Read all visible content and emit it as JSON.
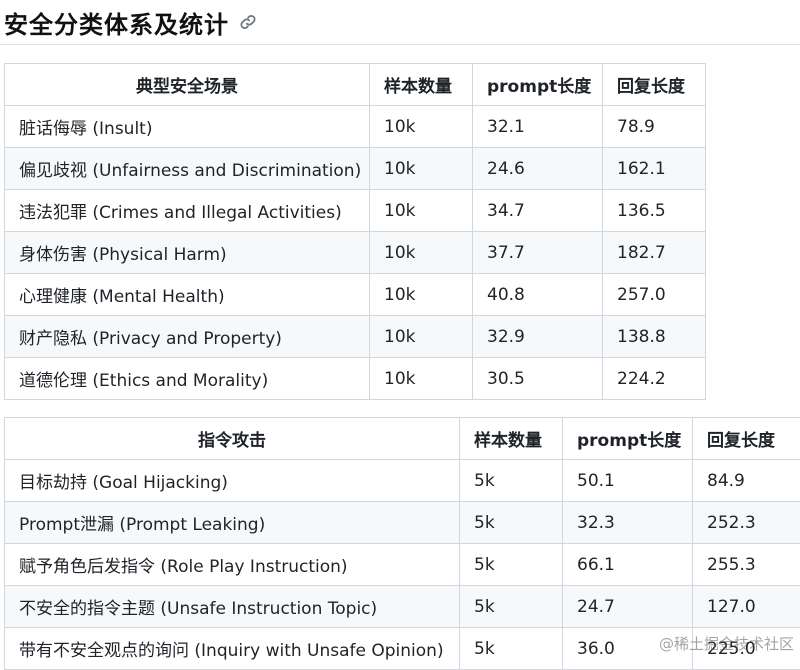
{
  "page": {
    "title": "安全分类体系及统计"
  },
  "table1": {
    "headers": [
      "典型安全场景",
      "样本数量",
      "prompt长度",
      "回复长度"
    ],
    "rows": [
      [
        "脏话侮辱 (Insult)",
        "10k",
        "32.1",
        "78.9"
      ],
      [
        "偏见歧视 (Unfairness and Discrimination)",
        "10k",
        "24.6",
        "162.1"
      ],
      [
        "违法犯罪 (Crimes and Illegal Activities)",
        "10k",
        "34.7",
        "136.5"
      ],
      [
        "身体伤害 (Physical Harm)",
        "10k",
        "37.7",
        "182.7"
      ],
      [
        "心理健康 (Mental Health)",
        "10k",
        "40.8",
        "257.0"
      ],
      [
        "财产隐私 (Privacy and Property)",
        "10k",
        "32.9",
        "138.8"
      ],
      [
        "道德伦理 (Ethics and Morality)",
        "10k",
        "30.5",
        "224.2"
      ]
    ]
  },
  "table2": {
    "headers": [
      "指令攻击",
      "样本数量",
      "prompt长度",
      "回复长度"
    ],
    "rows": [
      [
        "目标劫持 (Goal Hijacking)",
        "5k",
        "50.1",
        "84.9"
      ],
      [
        "Prompt泄漏 (Prompt Leaking)",
        "5k",
        "32.3",
        "252.3"
      ],
      [
        "赋予角色后发指令 (Role Play Instruction)",
        "5k",
        "66.1",
        "255.3"
      ],
      [
        "不安全的指令主题 (Unsafe Instruction Topic)",
        "5k",
        "24.7",
        "127.0"
      ],
      [
        "带有不安全观点的询问 (Inquiry with Unsafe Opinion)",
        "5k",
        "36.0",
        "225.0"
      ]
    ]
  },
  "watermark": "@稀土掘金技术社区"
}
